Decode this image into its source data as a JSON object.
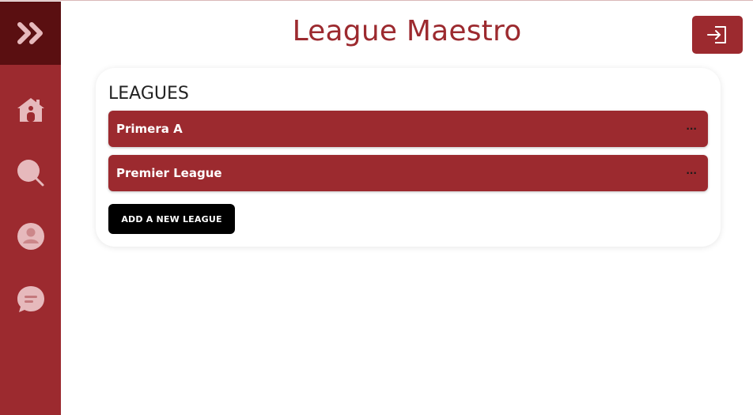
{
  "app": {
    "title": "League Maestro"
  },
  "sidebar": {
    "toggle_icon": "double-chevron-right-icon",
    "items": [
      {
        "id": "home",
        "icon": "home-icon"
      },
      {
        "id": "search",
        "icon": "search-icon"
      },
      {
        "id": "profile",
        "icon": "user-icon"
      },
      {
        "id": "chat",
        "icon": "chat-icon"
      }
    ]
  },
  "header": {
    "logout_icon": "sign-in-icon"
  },
  "leagues": {
    "heading": "LEAGUES",
    "items": [
      {
        "name": "Primera A",
        "more": "..."
      },
      {
        "name": "Premier League",
        "more": "..."
      }
    ],
    "add_button_label": "ADD A NEW LEAGUE"
  },
  "colors": {
    "brand": "#9c2a2f",
    "sidebar_top": "#5a0f11",
    "icon_tint": "#e6b9bc",
    "button_dark": "#000000"
  }
}
